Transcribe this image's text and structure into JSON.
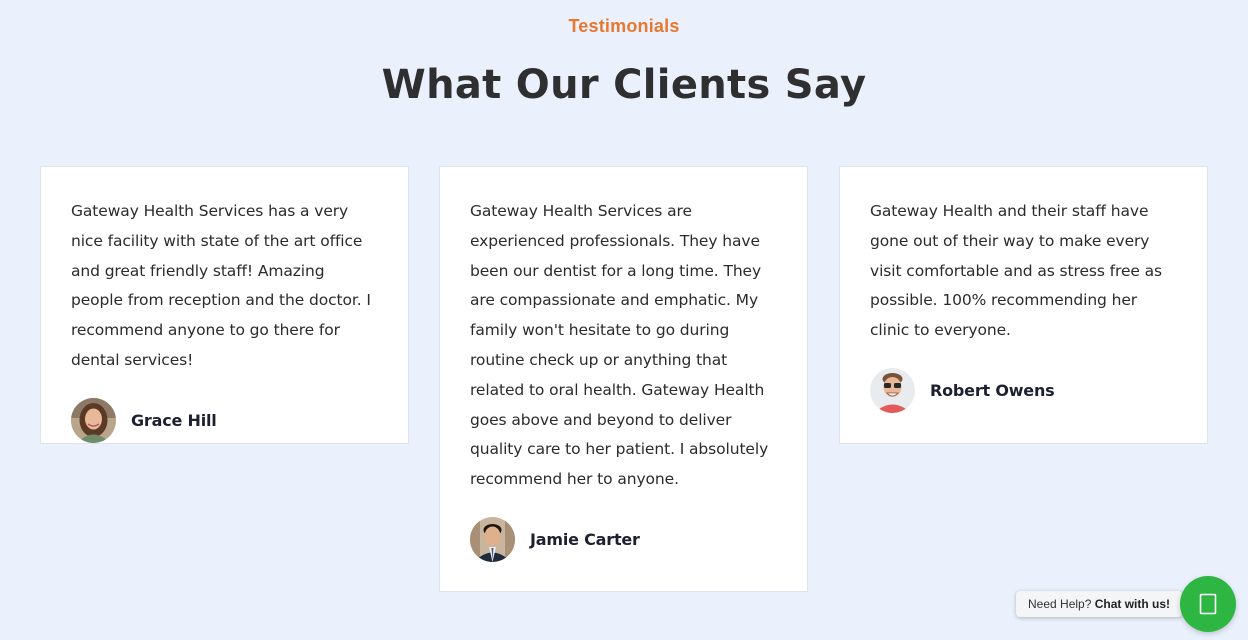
{
  "section": {
    "eyebrow": "Testimonials",
    "title": "What Our Clients Say"
  },
  "testimonials": [
    {
      "text": "Gateway Health Services has a very nice facility with state of the art office and great friendly staff! Amazing people from reception and the doctor. I recommend anyone to go there for dental services!",
      "name": "Grace Hill",
      "avatar_icon": "woman-portrait"
    },
    {
      "text": "Gateway Health Services are experienced professionals. They have been our dentist for a long time. They are compassionate and emphatic. My family won't hesitate to go during routine check up or anything that related to oral health. Gateway Health goes above and beyond to deliver quality care to her patient. I absolutely recommend her to anyone.",
      "name": "Jamie Carter",
      "avatar_icon": "man-portrait-suit"
    },
    {
      "text": "Gateway Health and their staff have gone out of their way to make every visit comfortable and as stress free as possible. 100% recommending her clinic to everyone.",
      "name": "Robert Owens",
      "avatar_icon": "man-portrait-glasses"
    }
  ],
  "chat": {
    "prefix": "Need Help?",
    "action": "Chat with us!",
    "icon": "chat-icon",
    "button_color": "#2db742"
  },
  "colors": {
    "background": "#eaf1fd",
    "accent": "#e8782f",
    "heading": "#2f2f31"
  }
}
